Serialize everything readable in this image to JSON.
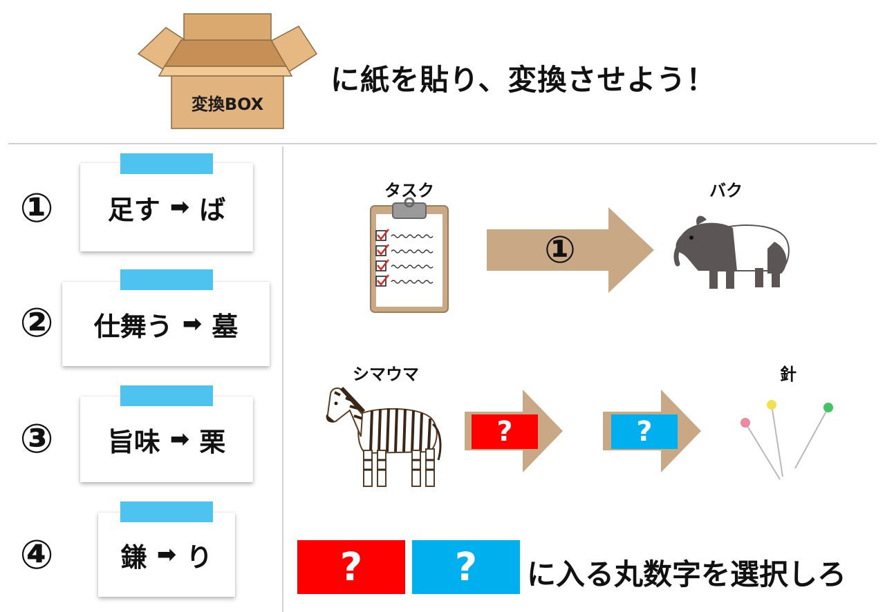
{
  "header": {
    "box_label": "変換BOX",
    "title": "に紙を貼り、変換させよう！"
  },
  "rules": [
    {
      "num": "①",
      "from": "足す",
      "arrow": "➡",
      "to": "ば"
    },
    {
      "num": "②",
      "from": "仕舞う",
      "arrow": "➡",
      "to": "墓"
    },
    {
      "num": "③",
      "from": "旨味",
      "arrow": "➡",
      "to": "栗"
    },
    {
      "num": "④",
      "from": "鎌",
      "arrow": "➡",
      "to": "り"
    }
  ],
  "example": {
    "from_label": "タスク",
    "arrow_label": "①",
    "to_label": "バク"
  },
  "puzzle": {
    "from_label": "シマウマ",
    "q1": "?",
    "q2": "?",
    "to_label": "針"
  },
  "instruction": {
    "q_red": "?",
    "q_blue": "?",
    "text": "に入る丸数字を選択しろ"
  },
  "colors": {
    "tape": "#4ec3ef",
    "red": "#ff0000",
    "blue": "#00b0ee",
    "arrow": "#c9a886",
    "box": "#e1b37f"
  }
}
